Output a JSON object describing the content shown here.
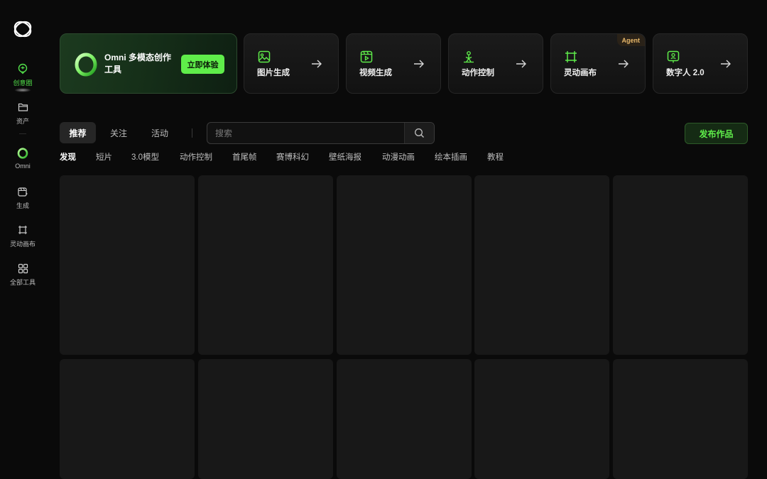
{
  "sidebar": {
    "items": [
      {
        "label": "创意圈",
        "icon": "creative-circle-icon",
        "active": true
      },
      {
        "label": "资产",
        "icon": "folder-icon",
        "active": false
      },
      {
        "label": "Omni",
        "icon": "omni-ring-icon",
        "active": false
      },
      {
        "label": "生成",
        "icon": "generate-icon",
        "active": false
      },
      {
        "label": "灵动画布",
        "icon": "canvas-frame-icon",
        "active": false
      },
      {
        "label": "全部工具",
        "icon": "grid-apps-icon",
        "active": false
      }
    ]
  },
  "features": {
    "omni": {
      "title": "Omni 多模态创作工具",
      "cta": "立即体验"
    },
    "cards": [
      {
        "label": "图片生成",
        "icon": "image-icon"
      },
      {
        "label": "视频生成",
        "icon": "video-icon"
      },
      {
        "label": "动作控制",
        "icon": "motion-control-icon"
      },
      {
        "label": "灵动画布",
        "icon": "canvas-frame-icon",
        "badge": "Agent"
      },
      {
        "label": "数字人 2.0",
        "icon": "digital-human-icon"
      }
    ]
  },
  "tabs": [
    {
      "label": "推荐",
      "active": true
    },
    {
      "label": "关注",
      "active": false
    },
    {
      "label": "活动",
      "active": false
    }
  ],
  "search": {
    "placeholder": "搜索"
  },
  "publish_label": "发布作品",
  "categories": [
    {
      "label": "发现",
      "active": true
    },
    {
      "label": "短片"
    },
    {
      "label": "3.0模型"
    },
    {
      "label": "动作控制"
    },
    {
      "label": "首尾帧"
    },
    {
      "label": "赛博科幻"
    },
    {
      "label": "壁纸海报"
    },
    {
      "label": "动漫动画"
    },
    {
      "label": "绘本插画"
    },
    {
      "label": "教程"
    }
  ],
  "colors": {
    "accent": "#5fed4a",
    "background": "#0a0a0a",
    "tile": "#181818",
    "agent_badge": "#e8b86a"
  }
}
